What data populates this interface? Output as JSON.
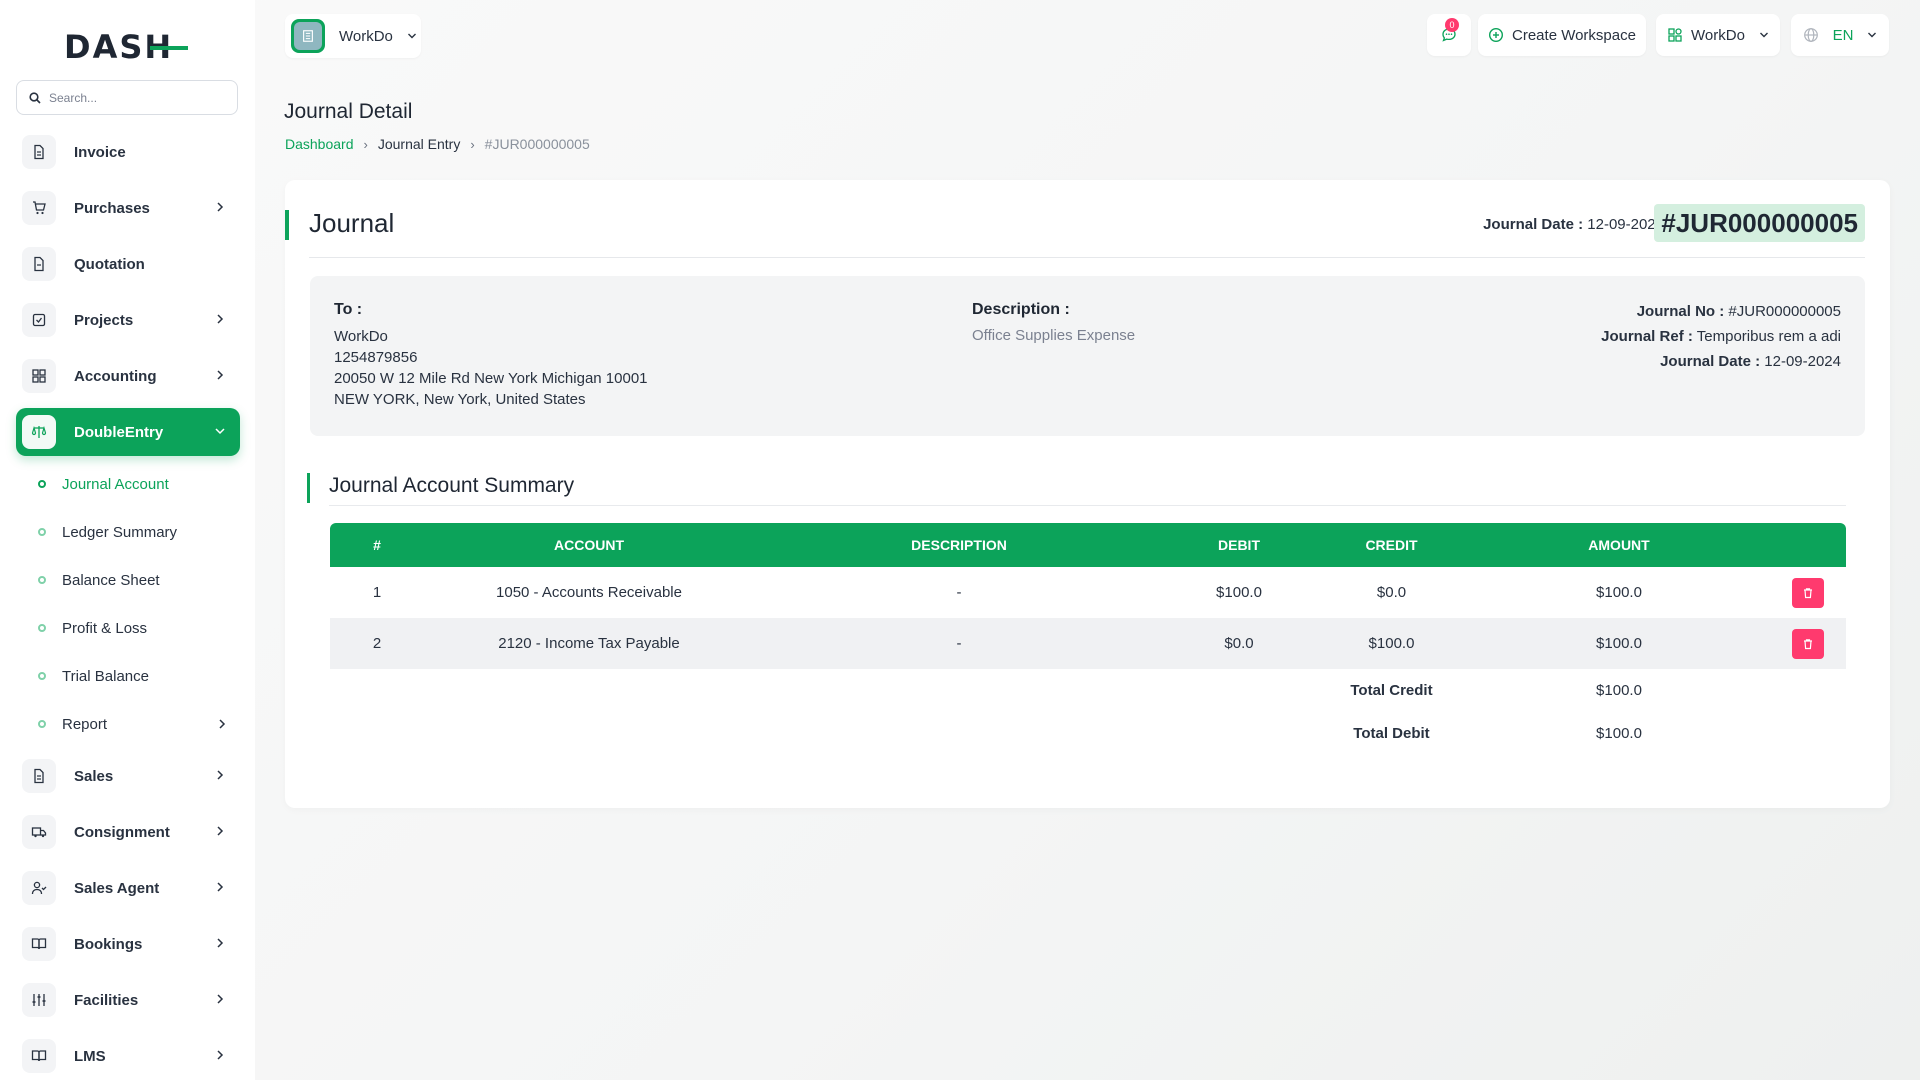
{
  "brand": {
    "logo_text": "DASH",
    "accent": "#0ca35a",
    "danger": "#ff3a6e"
  },
  "search": {
    "placeholder": "Search..."
  },
  "sidebar": {
    "items": [
      {
        "label": "Invoice",
        "icon": "file-icon"
      },
      {
        "label": "Purchases",
        "icon": "cart-icon"
      },
      {
        "label": "Quotation",
        "icon": "file-text-icon"
      },
      {
        "label": "Projects",
        "icon": "checklist-icon"
      },
      {
        "label": "Accounting",
        "icon": "grid-icon"
      },
      {
        "label": "DoubleEntry",
        "icon": "scale-icon"
      },
      {
        "label": "Sales",
        "icon": "file-icon"
      },
      {
        "label": "Consignment",
        "icon": "truck-icon"
      },
      {
        "label": "Sales Agent",
        "icon": "user-check-icon"
      },
      {
        "label": "Bookings",
        "icon": "book-icon"
      },
      {
        "label": "Facilities",
        "icon": "sliders-icon"
      },
      {
        "label": "LMS",
        "icon": "book-open-icon"
      }
    ],
    "subitems": [
      {
        "label": "Journal Account"
      },
      {
        "label": "Ledger Summary"
      },
      {
        "label": "Balance Sheet"
      },
      {
        "label": "Profit & Loss"
      },
      {
        "label": "Trial Balance"
      },
      {
        "label": "Report"
      }
    ]
  },
  "header": {
    "workspace": "WorkDo",
    "notification_count": "0",
    "create_workspace": "Create Workspace",
    "user_menu": "WorkDo",
    "language": "EN"
  },
  "page": {
    "title": "Journal Detail",
    "breadcrumb": [
      "Dashboard",
      "Journal Entry",
      "#JUR000000005"
    ]
  },
  "journal": {
    "heading": "Journal",
    "date_label": "Journal Date :",
    "date": "12-09-2024",
    "number": "#JUR000000005",
    "to_label": "To :",
    "to_lines": [
      "WorkDo",
      "1254879856",
      "20050 W 12 Mile Rd New York Michigan 10001",
      "NEW YORK, New York, United States"
    ],
    "description_label": "Description :",
    "description": "Office Supplies Expense",
    "no_label": "Journal No :",
    "no_value": "#JUR000000005",
    "ref_label": "Journal Ref :",
    "ref_value": "Temporibus rem a adi",
    "date2_label": "Journal Date :",
    "date2_value": "12-09-2024"
  },
  "summary": {
    "title": "Journal Account Summary",
    "columns": [
      "#",
      "ACCOUNT",
      "DESCRIPTION",
      "DEBIT",
      "CREDIT",
      "AMOUNT"
    ],
    "rows": [
      {
        "num": "1",
        "account": "1050 - Accounts Receivable",
        "description": "-",
        "debit": "$100.0",
        "credit": "$0.0",
        "amount": "$100.0"
      },
      {
        "num": "2",
        "account": "2120 - Income Tax Payable",
        "description": "-",
        "debit": "$0.0",
        "credit": "$100.0",
        "amount": "$100.0"
      }
    ],
    "total_credit_label": "Total Credit",
    "total_credit": "$100.0",
    "total_debit_label": "Total Debit",
    "total_debit": "$100.0"
  }
}
